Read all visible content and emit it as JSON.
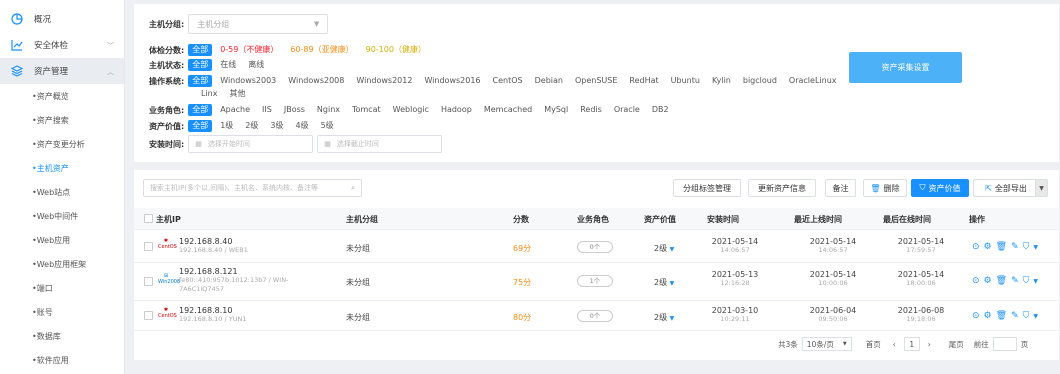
{
  "sidebar": {
    "items": [
      {
        "label": "概况",
        "icon": "dashboard-icon"
      },
      {
        "label": "安全体检",
        "icon": "chart-line-icon"
      },
      {
        "label": "资产管理",
        "icon": "layers-icon"
      }
    ],
    "subitems": [
      "•资产概览",
      "•资产搜索",
      "•资产变更分析",
      "•主机资产",
      "•Web站点",
      "•Web中间件",
      "•Web应用",
      "•Web应用框架",
      "•端口",
      "•账号",
      "•数据库",
      "•软件应用"
    ]
  },
  "filter": {
    "group_label": "主机分组:",
    "group_placeholder": "主机分组",
    "score_label": "体检分数:",
    "score_tags": [
      "全部",
      "0-59（不健康）",
      "60-89（亚健康）",
      "90-100（健康）"
    ],
    "status_label": "主机状态:",
    "status_tags": [
      "全部",
      "在线",
      "离线"
    ],
    "os_label": "操作系统:",
    "os_tags": [
      "全部",
      "Windows2003",
      "Windows2008",
      "Windows2012",
      "Windows2016",
      "CentOS",
      "Debian",
      "OpenSUSE",
      "RedHat",
      "Ubuntu",
      "Kylin",
      "bigcloud",
      "OracleLinux"
    ],
    "os_tags_2": [
      "Linx",
      "其他"
    ],
    "role_label": "业务角色:",
    "role_tags": [
      "全部",
      "Apache",
      "IIS",
      "JBoss",
      "Nginx",
      "Tomcat",
      "Weblogic",
      "Hadoop",
      "Memcached",
      "MySql",
      "Redis",
      "Oracle",
      "DB2"
    ],
    "value_label": "资产价值:",
    "value_tags": [
      "全部",
      "1级",
      "2级",
      "3级",
      "4级",
      "5级"
    ],
    "install_label": "安装时间:",
    "start_placeholder": "选择开始时间",
    "end_placeholder": "选择截止时间",
    "collect_button": "资产采集设置"
  },
  "toolbar": {
    "search_placeholder": "搜索主机IP(多个以,间隔)、主机名、系统内核、备注等",
    "group_manage": "分组标签管理",
    "refresh": "更新资产信息",
    "note": "备注",
    "delete": "删除",
    "asset_value": "资产价值",
    "export_all": "全部导出"
  },
  "table": {
    "headers": [
      "主机IP",
      "主机分组",
      "分数",
      "业务角色",
      "资产价值",
      "安装时间",
      "最近上线时间",
      "最后在线时间",
      "操作"
    ],
    "rows": [
      {
        "os": "CentOS",
        "ip": "192.168.8.40",
        "sub": "192.168.8.40 / WEB1",
        "sub2": "",
        "group": "未分组",
        "score": "69分",
        "role": "0个",
        "value": "2级",
        "install_d": "2021-05-14",
        "install_t": "14:06:57",
        "online_d": "2021-05-14",
        "online_t": "14:06:57",
        "last_d": "2021-05-14",
        "last_t": "17:59:57"
      },
      {
        "os": "Win2008",
        "ip": "192.168.8.121",
        "sub": "fe80::410:957b:1012:13b7 / WIN-",
        "sub2": "7A6C1IQ7457",
        "group": "未分组",
        "score": "75分",
        "role": "1个",
        "value": "2级",
        "install_d": "2021-05-13",
        "install_t": "12:16:28",
        "online_d": "2021-05-14",
        "online_t": "10:00:06",
        "last_d": "2021-05-14",
        "last_t": "18:00:06"
      },
      {
        "os": "CentOS",
        "ip": "192.168.8.10",
        "sub": "192.168.8.10 / YUN1",
        "sub2": "",
        "group": "未分组",
        "score": "80分",
        "role": "0个",
        "value": "2级",
        "install_d": "2021-03-10",
        "install_t": "10:29:11",
        "online_d": "2021-06-04",
        "online_t": "09:50:06",
        "last_d": "2021-06-08",
        "last_t": "19:18:06"
      }
    ]
  },
  "pager": {
    "total": "共3条",
    "per_page": "10条/页",
    "first": "首页",
    "page": "1",
    "last": "尾页",
    "goto": "前往",
    "page_unit": "页"
  },
  "colors": {
    "primary": "#1890ff",
    "collect": "#4db1f7",
    "score": "#fa8c16"
  }
}
